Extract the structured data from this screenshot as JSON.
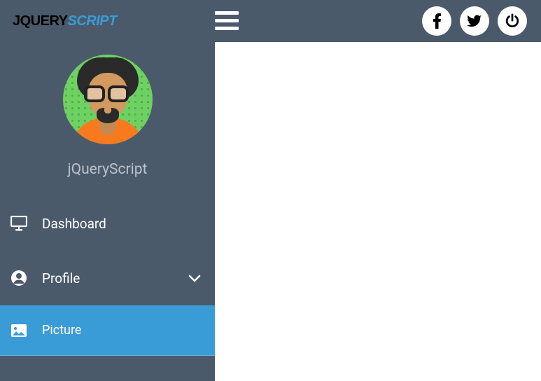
{
  "logo": {
    "first": "JQUERY",
    "second": "SCRIPT"
  },
  "user": {
    "name": "jQueryScript"
  },
  "nav": {
    "dashboard": {
      "label": "Dashboard"
    },
    "profile": {
      "label": "Profile"
    },
    "picture": {
      "label": "Picture"
    }
  },
  "icons": {
    "facebook": "facebook-icon",
    "twitter": "twitter-icon",
    "power": "power-icon",
    "menu": "hamburger-icon",
    "monitor": "monitor-icon",
    "account": "account-circle-icon",
    "chevron": "chevron-down-icon",
    "image": "image-icon"
  }
}
